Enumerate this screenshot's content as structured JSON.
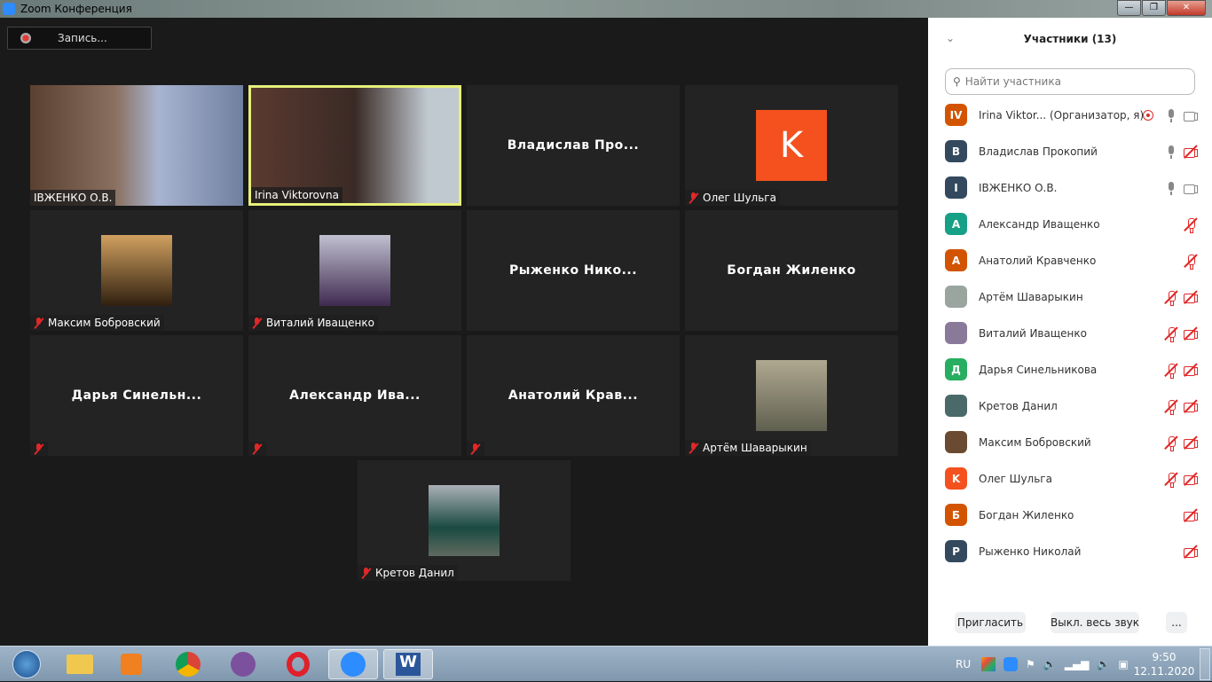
{
  "window": {
    "title": "Zoom Конференция",
    "min": "—",
    "max": "❐",
    "close": "✕"
  },
  "recording": {
    "label": "Запись..."
  },
  "tiles": [
    {
      "name": "ІВЖЕНКО О.В.",
      "type": "video",
      "muted": false
    },
    {
      "name": "Irina Viktorovna",
      "type": "video",
      "muted": false,
      "active": true
    },
    {
      "name": "Владислав  Про...",
      "type": "name"
    },
    {
      "name": "Олег Шульга",
      "type": "avatar",
      "letter": "K",
      "muted": true
    },
    {
      "name": "Максим Бобровский",
      "type": "thumb",
      "muted": true
    },
    {
      "name": "Виталий Иващенко",
      "type": "thumb",
      "muted": true
    },
    {
      "name": "Рыженко  Нико...",
      "type": "name"
    },
    {
      "name": "Богдан Жиленко",
      "type": "name"
    },
    {
      "name": "Дарья  Синельн...",
      "type": "name",
      "muted": true
    },
    {
      "name": "Александр  Ива...",
      "type": "name",
      "muted": true
    },
    {
      "name": "Анатолий  Крав...",
      "type": "name",
      "muted": true
    },
    {
      "name": "Артём Шаварыкин",
      "type": "thumb",
      "muted": true
    },
    {
      "name": "Кретов Данил",
      "type": "thumb",
      "muted": true
    }
  ],
  "panel": {
    "title": "Участники (13)",
    "search_placeholder": "Найти участника",
    "participants": [
      {
        "name": "Irina Viktor...  (Организатор, я)",
        "avatar": "IV",
        "color": "#d35400",
        "icons": [
          "rec",
          "mic",
          "cam"
        ]
      },
      {
        "name": "Владислав Прокопий",
        "avatar": "B",
        "color": "#34495e",
        "icons": [
          "mic",
          "cam-off"
        ]
      },
      {
        "name": "ІВЖЕНКО О.В.",
        "avatar": "I",
        "color": "#34495e",
        "icons": [
          "mic",
          "cam"
        ]
      },
      {
        "name": "Александр Иващенко",
        "avatar": "А",
        "color": "#16a085",
        "icons": [
          "mic-off"
        ]
      },
      {
        "name": "Анатолий Кравченко",
        "avatar": "А",
        "color": "#d35400",
        "icons": [
          "mic-off"
        ]
      },
      {
        "name": "Артём Шаварыкин",
        "avatar": "",
        "color": "#9aa5a0",
        "icons": [
          "mic-off",
          "cam-off"
        ]
      },
      {
        "name": "Виталий Иващенко",
        "avatar": "",
        "color": "#8a7a9a",
        "icons": [
          "mic-off",
          "cam-off"
        ]
      },
      {
        "name": "Дарья Синельникова",
        "avatar": "Д",
        "color": "#27ae60",
        "icons": [
          "mic-off",
          "cam-off"
        ]
      },
      {
        "name": "Кретов Данил",
        "avatar": "",
        "color": "#4a6a6a",
        "icons": [
          "mic-off",
          "cam-off"
        ]
      },
      {
        "name": "Максим Бобровский",
        "avatar": "",
        "color": "#6a4a30",
        "icons": [
          "mic-off",
          "cam-off"
        ]
      },
      {
        "name": "Олег Шульга",
        "avatar": "K",
        "color": "#f4511e",
        "icons": [
          "mic-off",
          "cam-off"
        ]
      },
      {
        "name": "Богдан Жиленко",
        "avatar": "Б",
        "color": "#d35400",
        "icons": [
          "cam-off"
        ]
      },
      {
        "name": "Рыженко Николай",
        "avatar": "P",
        "color": "#34495e",
        "icons": [
          "cam-off"
        ]
      }
    ],
    "invite": "Пригласить",
    "mute_all": "Выкл. весь звук",
    "more": "..."
  },
  "taskbar": {
    "lang": "RU",
    "time": "9:50",
    "date": "12.11.2020"
  }
}
